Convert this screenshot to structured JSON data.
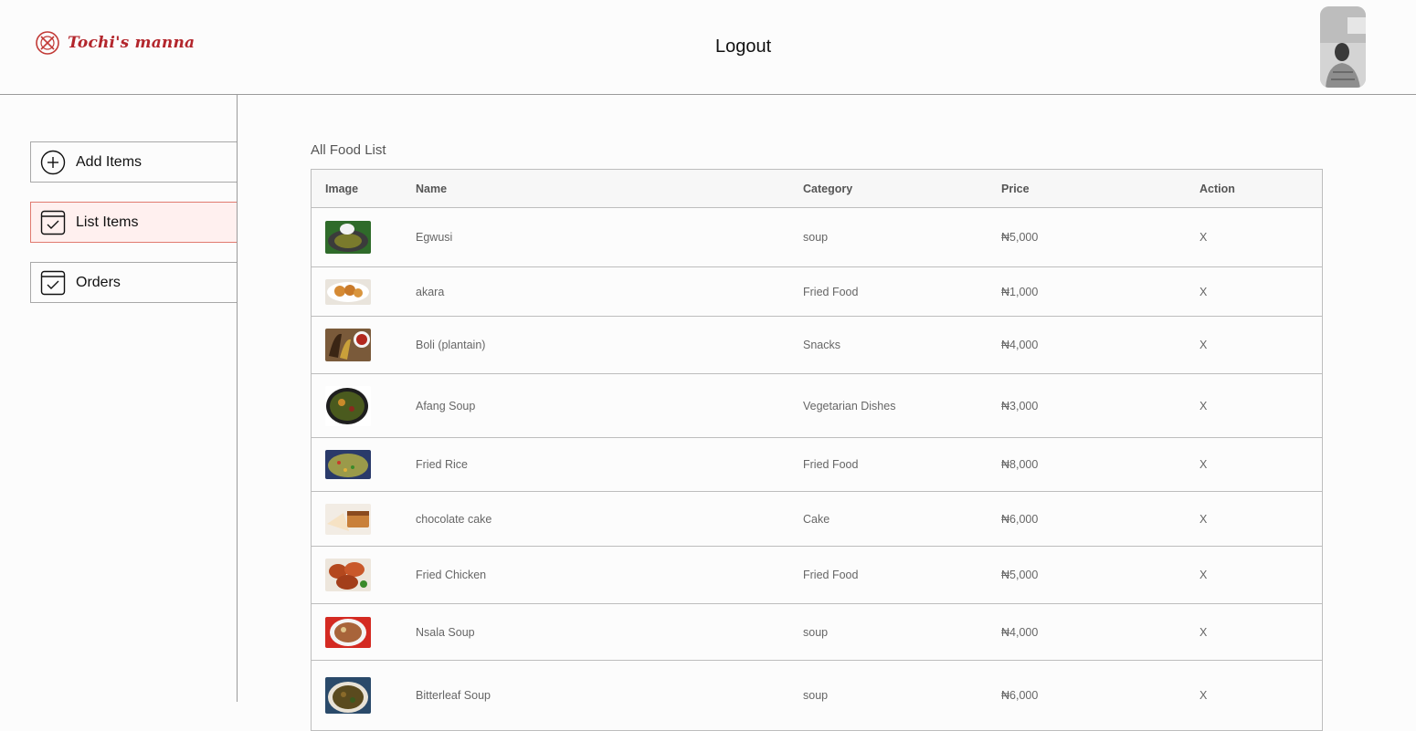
{
  "header": {
    "brand": "Tochi's manna",
    "logout_label": "Logout",
    "brand_color": "#b3262c"
  },
  "sidebar": {
    "items": [
      {
        "label": "Add Items",
        "icon": "plus-circle-icon"
      },
      {
        "label": "List Items",
        "icon": "checklist-icon"
      },
      {
        "label": "Orders",
        "icon": "checklist-icon"
      }
    ],
    "active_color": "#fff0ef"
  },
  "main": {
    "title": "All Food List",
    "columns": [
      "Image",
      "Name",
      "Category",
      "Price",
      "Action"
    ],
    "rows": [
      {
        "name": "Egwusi",
        "category": "soup",
        "price": "₦5,000",
        "action": "X",
        "img_color": "#5b6a2c"
      },
      {
        "name": "akara",
        "category": "Fried Food",
        "price": "₦1,000",
        "action": "X",
        "img_color": "#d38a3a"
      },
      {
        "name": "Boli (plantain)",
        "category": "Snacks",
        "price": "₦4,000",
        "action": "X",
        "img_color": "#6b3f22"
      },
      {
        "name": "Afang Soup",
        "category": "Vegetarian Dishes",
        "price": "₦3,000",
        "action": "X",
        "img_color": "#3b4a1e"
      },
      {
        "name": "Fried Rice",
        "category": "Fried Food",
        "price": "₦8,000",
        "action": "X",
        "img_color": "#8a8a3a"
      },
      {
        "name": "chocolate cake",
        "category": "Cake",
        "price": "₦6,000",
        "action": "X",
        "img_color": "#c98a4a"
      },
      {
        "name": "Fried Chicken",
        "category": "Fried Food",
        "price": "₦5,000",
        "action": "X",
        "img_color": "#b5502a"
      },
      {
        "name": "Nsala Soup",
        "category": "soup",
        "price": "₦4,000",
        "action": "X",
        "img_color": "#9a5a30"
      },
      {
        "name": "Bitterleaf Soup",
        "category": "soup",
        "price": "₦6,000",
        "action": "X",
        "img_color": "#5a4a2a"
      }
    ]
  }
}
